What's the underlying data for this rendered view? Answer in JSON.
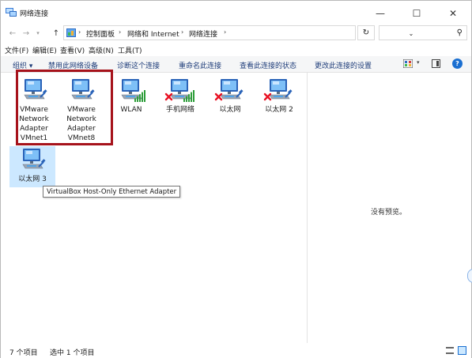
{
  "window": {
    "title": "网络连接",
    "minimize_glyph": "—",
    "maximize_glyph": "☐",
    "close_glyph": "✕"
  },
  "address": {
    "crumbs": [
      "控制面板",
      "网络和 Internet",
      "网络连接"
    ],
    "separator": "›",
    "dropdown_glyph": "⌄",
    "refresh_glyph": "↻",
    "search_placeholder": "",
    "search_glyph": "⚲"
  },
  "menu": [
    "文件(F)",
    "编辑(E)",
    "查看(V)",
    "高级(N)",
    "工具(T)"
  ],
  "commands": {
    "organize": "组织 ▾",
    "disable": "禁用此网络设备",
    "diagnose": "诊断这个连接",
    "rename": "重命名此连接",
    "status": "查看此连接的状态",
    "settings": "更改此连接的设置",
    "view_dropdown": "▾",
    "help": "?"
  },
  "connections": [
    {
      "label": "VMware\nNetwork\nAdapter\nVMnet1",
      "type": "adapter",
      "disconnected": false
    },
    {
      "label": "VMware\nNetwork\nAdapter\nVMnet8",
      "type": "adapter",
      "disconnected": false
    },
    {
      "label": "WLAN",
      "type": "wifi",
      "disconnected": false
    },
    {
      "label": "手机网络",
      "type": "wifi",
      "disconnected": true
    },
    {
      "label": "以太网",
      "type": "ethernet",
      "disconnected": true
    },
    {
      "label": "以太网 2",
      "type": "ethernet",
      "disconnected": true
    },
    {
      "label": "以太网 3",
      "type": "adapter",
      "disconnected": false,
      "selected": true
    }
  ],
  "tooltip": "VirtualBox Host-Only Ethernet Adapter",
  "preview": {
    "empty_text": "没有预览。"
  },
  "status": {
    "item_count": "7 个项目",
    "selected": "选中 1 个项目"
  },
  "colors": {
    "highlight_border": "#a6121b",
    "selection": "#cce8ff",
    "command_text": "#1f3d7a",
    "disconnect_x": "#e81123",
    "signal_green": "#2e9e3a"
  }
}
